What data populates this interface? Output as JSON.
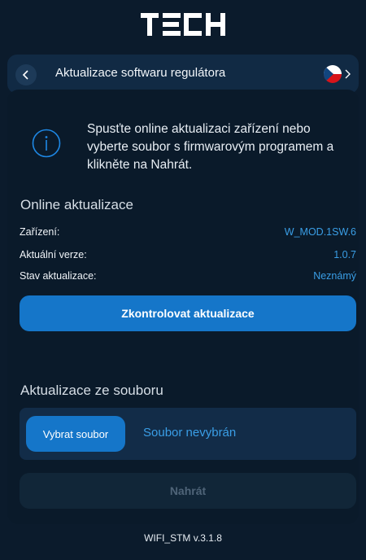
{
  "brand": {
    "logo_text": "TECH"
  },
  "header": {
    "back_icon": "chevron-left-icon",
    "title": "Aktualizace softwaru regulátora",
    "language": "cz-flag-icon",
    "next_icon": "chevron-right-icon"
  },
  "info": {
    "icon": "info-icon",
    "text": "Spusťte online aktualizaci zařízení nebo vyberte soubor s firmwarovým programem a klikněte na Nahrát."
  },
  "online": {
    "title": "Online aktualizace",
    "rows": [
      {
        "label": "Zařízení:",
        "value": "W_MOD.1SW.6"
      },
      {
        "label": "Aktuální verze:",
        "value": "1.0.7"
      },
      {
        "label": "Stav aktualizace:",
        "value": "Neznámý"
      }
    ],
    "check_button": "Zkontrolovat aktualizace"
  },
  "file": {
    "title": "Aktualizace ze souboru",
    "choose_button": "Vybrat soubor",
    "status": "Soubor nevybrán",
    "upload_button": "Nahrát"
  },
  "footer": {
    "version": "WIFI_STM v.3.1.8"
  },
  "colors": {
    "accent": "#1576c9",
    "value": "#3a9ee6",
    "background": "#0b1b2c"
  }
}
